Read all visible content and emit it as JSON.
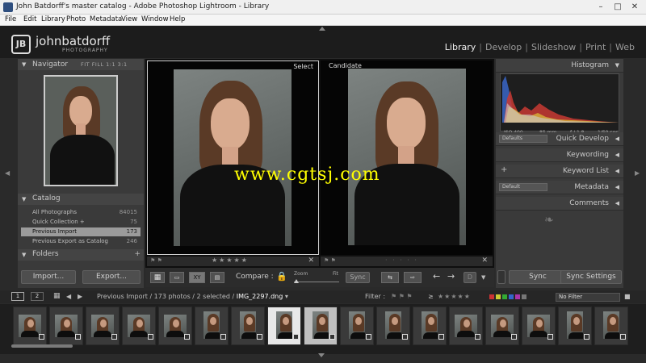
{
  "window": {
    "title": "John Batdorff's master catalog - Adobe Photoshop Lightroom - Library",
    "controls": {
      "minimize": "–",
      "maximize": "□",
      "close": "✕"
    }
  },
  "menu": [
    "File",
    "Edit",
    "Library",
    "Photo",
    "Metadata",
    "View",
    "Window",
    "Help"
  ],
  "header": {
    "logo_mark": "JB",
    "logo_name": "johnbatdorff",
    "logo_sub": "PHOTOGRAPHY",
    "modules": [
      "Library",
      "Develop",
      "Slideshow",
      "Print",
      "Web"
    ],
    "active_module": "Library",
    "separator": "|"
  },
  "navigator": {
    "label": "Navigator",
    "zoom_options": "FIT  FILL  1:1  3:1"
  },
  "catalog": {
    "label": "Catalog",
    "items": [
      {
        "name": "All Photographs",
        "count": "84015"
      },
      {
        "name": "Quick Collection +",
        "count": "75"
      },
      {
        "name": "Previous Import",
        "count": "173"
      },
      {
        "name": "Previous Export as Catalog",
        "count": "246"
      }
    ],
    "selected_index": 2
  },
  "folders": {
    "label": "Folders",
    "add": "+"
  },
  "left_buttons": {
    "import": "Import...",
    "export": "Export..."
  },
  "compare": {
    "select_label": "Select",
    "candidate_label": "Candidate",
    "stars": "★★★★★",
    "candidate_stars": "· · · · ·",
    "close": "✕"
  },
  "toolbar": {
    "compare_label": "Compare :",
    "zoom_label": "Zoom",
    "fit_label": "Fit",
    "sync_label": "Sync",
    "xy_label": "XY",
    "done_label": "D"
  },
  "right_panel": {
    "histogram_label": "Histogram",
    "histogram_info": {
      "iso": "ISO 400",
      "focal": "85 mm",
      "aperture": "f / 1.8",
      "shutter": "1/50 sec"
    },
    "quick_develop": {
      "preset": "Defaults",
      "label": "Quick Develop"
    },
    "keywording_label": "Keywording",
    "keyword_list": {
      "add": "+",
      "label": "Keyword List"
    },
    "metadata": {
      "preset": "Default",
      "label": "Metadata"
    },
    "comments_label": "Comments",
    "ornament": "❧"
  },
  "right_buttons": {
    "sync": "Sync",
    "sync_settings": "Sync Settings"
  },
  "filmstrip_bar": {
    "page1": "1",
    "page2": "2",
    "path_prefix": "Previous Import / 173 photos / 2 selected /",
    "current_file": "IMG_2297.dng",
    "filter_label": "Filter :",
    "rating_op": "≥",
    "stars": "★★★★★",
    "filter_value": "No Filter"
  },
  "watermark": "www.cgtsj.com",
  "colors": {
    "accent_select": "#cfcfcf",
    "histogram_red": "#c83a32",
    "histogram_blue": "#3a66c8",
    "histogram_yellow": "#d6b43a",
    "watermark": "#ffff00"
  }
}
